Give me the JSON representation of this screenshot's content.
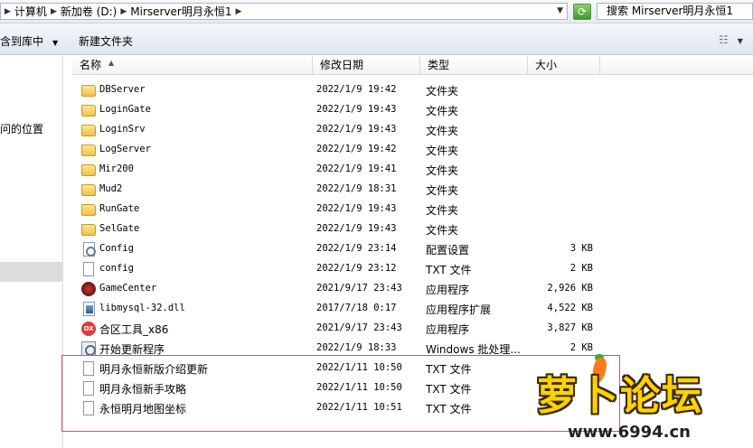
{
  "address_bar": {
    "path": [
      "计算机",
      "新加卷 (D:)",
      "Mirserver明月永恒1"
    ],
    "search_placeholder": "搜索 Mirserver明月永恒1"
  },
  "toolbar": {
    "include_in_library": "含到库中",
    "new_folder": "新建文件夹"
  },
  "nav": {
    "items": [
      "问的位置"
    ]
  },
  "columns": {
    "name": "名称",
    "modified": "修改日期",
    "type": "类型",
    "size": "大小"
  },
  "files": [
    {
      "name": "DBServer",
      "date": "2022/1/9 19:42",
      "type": "文件夹",
      "size": "",
      "icon": "folder-icon"
    },
    {
      "name": "LoginGate",
      "date": "2022/1/9 19:43",
      "type": "文件夹",
      "size": "",
      "icon": "folder-icon"
    },
    {
      "name": "LoginSrv",
      "date": "2022/1/9 19:43",
      "type": "文件夹",
      "size": "",
      "icon": "folder-icon"
    },
    {
      "name": "LogServer",
      "date": "2022/1/9 19:42",
      "type": "文件夹",
      "size": "",
      "icon": "folder-icon"
    },
    {
      "name": "Mir200",
      "date": "2022/1/9 19:41",
      "type": "文件夹",
      "size": "",
      "icon": "folder-icon"
    },
    {
      "name": "Mud2",
      "date": "2022/1/9 18:31",
      "type": "文件夹",
      "size": "",
      "icon": "folder-icon"
    },
    {
      "name": "RunGate",
      "date": "2022/1/9 19:43",
      "type": "文件夹",
      "size": "",
      "icon": "folder-icon"
    },
    {
      "name": "SelGate",
      "date": "2022/1/9 19:43",
      "type": "文件夹",
      "size": "",
      "icon": "folder-icon"
    },
    {
      "name": "Config",
      "date": "2022/1/9 23:14",
      "type": "配置设置",
      "size": "3 KB",
      "icon": "config-file-icon"
    },
    {
      "name": "config",
      "date": "2022/1/9 23:12",
      "type": "TXT 文件",
      "size": "2 KB",
      "icon": "text-file-icon"
    },
    {
      "name": "GameCenter",
      "date": "2021/9/17 23:43",
      "type": "应用程序",
      "size": "2,926 KB",
      "icon": "gamecenter-app-icon"
    },
    {
      "name": "libmysql-32.dll",
      "date": "2017/7/18 0:17",
      "type": "应用程序扩展",
      "size": "4,522 KB",
      "icon": "dll-file-icon"
    },
    {
      "name": "合区工具_x86",
      "date": "2021/9/17 23:43",
      "type": "应用程序",
      "size": "3,827 KB",
      "icon": "merge-tool-app-icon"
    },
    {
      "name": "开始更新程序",
      "date": "2022/1/9 18:33",
      "type": "Windows 批处理...",
      "size": "2 KB",
      "icon": "batch-file-icon"
    },
    {
      "name": "明月永恒新版介绍更新",
      "date": "2022/1/11 10:50",
      "type": "TXT 文件",
      "size": "",
      "icon": "text-file-icon"
    },
    {
      "name": "明月永恒新手攻略",
      "date": "2022/1/11 10:50",
      "type": "TXT 文件",
      "size": "",
      "icon": "text-file-icon"
    },
    {
      "name": "永恒明月地图坐标",
      "date": "2022/1/11 10:51",
      "type": "TXT 文件",
      "size": "",
      "icon": "text-file-icon"
    }
  ],
  "watermark": {
    "logo_text": "萝卜论坛",
    "url": "www.6994.cn"
  },
  "colors": {
    "annotation_red": "#e05050",
    "logo_yellow": "#ffd200"
  }
}
